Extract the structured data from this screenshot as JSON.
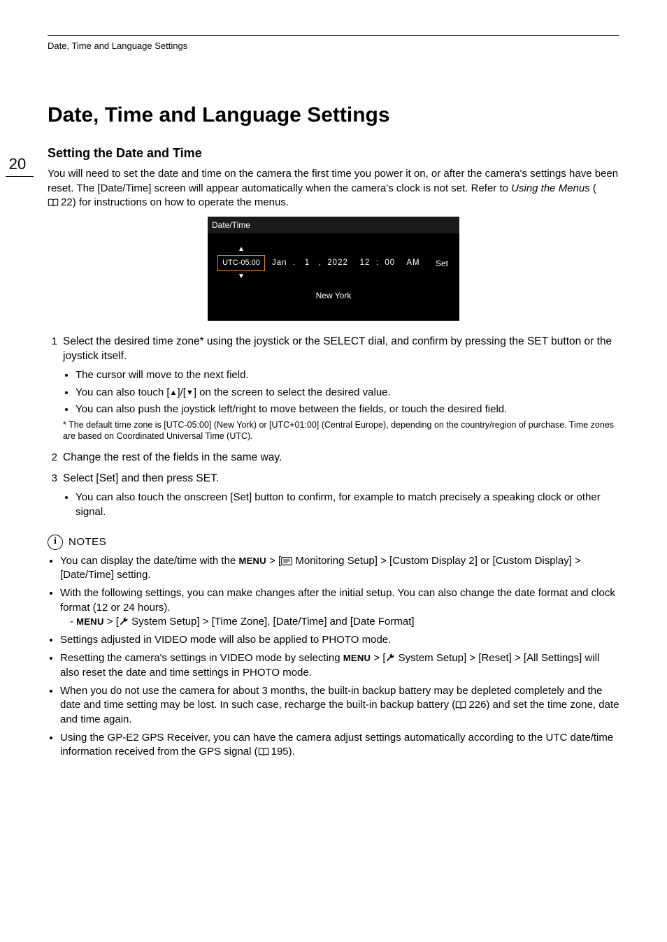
{
  "runningHead": "Date, Time and Language Settings",
  "pageNumber": "20",
  "h1": "Date, Time and Language Settings",
  "h2": "Setting the Date and Time",
  "intro": {
    "part1": "You will need to set the date and time on the camera the first time you power it on, or after the camera's settings have been reset. The [Date/Time] screen will appear automatically when the camera's clock is not set. Refer to ",
    "italic": "Using the Menus",
    "part2": " (",
    "refNum": "22",
    "part3": ") for instructions on how to operate the menus."
  },
  "lcd": {
    "title": "Date/Time",
    "utc": "UTC-05:00",
    "dateLine": "Jan  .   1   ,  2022    12  :  00    AM",
    "set": "Set",
    "city": "New York"
  },
  "steps": [
    {
      "num": "1",
      "head": "Select the desired time zone* using the joystick or the SELECT dial, and confirm by pressing the SET button or the joystick itself.",
      "bullets": [
        {
          "type": "plain",
          "text": "The cursor will move to the next field."
        },
        {
          "type": "arrows",
          "pre": "You can also touch [",
          "mid": "]/[",
          "post": "] on the screen to select the desired value."
        },
        {
          "type": "plain",
          "text": "You can also push the joystick left/right to move between the fields, or touch the desired field."
        }
      ],
      "footnote": "* The default time zone is [UTC-05:00] (New York) or [UTC+01:00] (Central Europe), depending on the country/region of purchase. Time zones are based on Coordinated Universal Time (UTC)."
    },
    {
      "num": "2",
      "head": "Change the rest of the fields in the same way."
    },
    {
      "num": "3",
      "head": "Select [Set] and then press SET.",
      "bullets": [
        {
          "type": "plain",
          "text": "You can also touch the onscreen [Set] button to confirm, for example to match precisely a speaking clock or other signal."
        }
      ]
    }
  ],
  "notes": {
    "label": "NOTES",
    "menuWord": "MENU",
    "items": [
      {
        "type": "menu-mon",
        "pre": "You can display the date/time with the ",
        "mid": " > [",
        "post1": " Monitoring Setup] > [Custom Display 2] or [Custom Display] > [Date/Time] setting."
      },
      {
        "type": "withsub",
        "text": "With the following settings, you can make changes after the initial setup. You can also change the date format and clock format (12 or 24 hours).",
        "sub": {
          "pre": "- ",
          "mid": " > [",
          "post": " System Setup] > [Time Zone], [Date/Time] and [Date Format]"
        }
      },
      {
        "type": "plain",
        "text": "Settings adjusted in VIDEO mode will also be applied to PHOTO mode."
      },
      {
        "type": "menu-wrench",
        "pre": "Resetting the camera's settings in VIDEO mode by selecting ",
        "mid": " > [",
        "post": " System Setup] > [Reset] > [All Settings] will also reset the date and time settings in PHOTO mode."
      },
      {
        "type": "pageref",
        "pre": "When you do not use the camera for about 3 months, the built-in backup battery may be depleted completely and the date and time setting may be lost. In such case, recharge the built-in backup battery (",
        "ref": "226",
        "post": ") and set the time zone, date and time again."
      },
      {
        "type": "pageref",
        "pre": "Using the GP-E2 GPS Receiver, you can have the camera adjust settings automatically according to the UTC date/time information received from the GPS signal (",
        "ref": "195",
        "post": ")."
      }
    ]
  }
}
